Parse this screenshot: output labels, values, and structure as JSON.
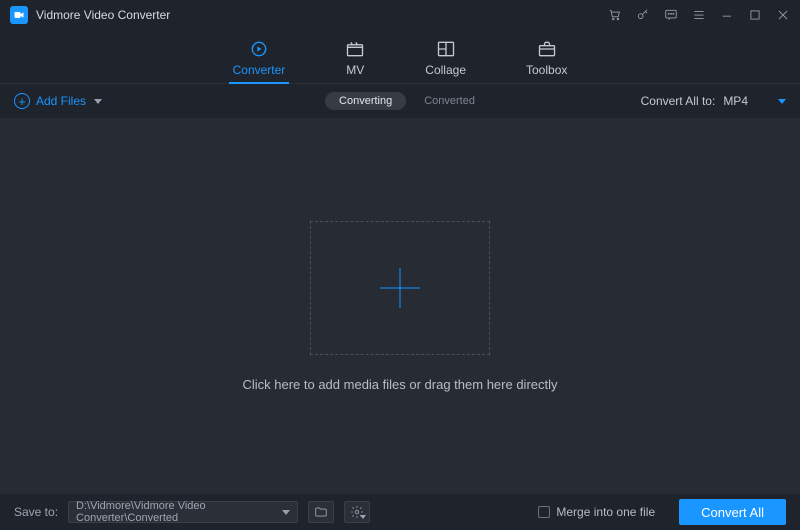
{
  "app": {
    "title": "Vidmore Video Converter"
  },
  "nav": {
    "converter": "Converter",
    "mv": "MV",
    "collage": "Collage",
    "toolbox": "Toolbox"
  },
  "secondary": {
    "add_files_label": "Add Files",
    "pill_converting": "Converting",
    "pill_converted": "Converted",
    "convert_all_to_label": "Convert All to:",
    "format_selected": "MP4"
  },
  "drop": {
    "hint": "Click here to add media files or drag them here directly"
  },
  "bottom": {
    "save_to_label": "Save to:",
    "save_path": "D:\\Vidmore\\Vidmore Video Converter\\Converted",
    "merge_label": "Merge into one file",
    "convert_all": "Convert All"
  },
  "colors": {
    "accent": "#1996ff"
  }
}
